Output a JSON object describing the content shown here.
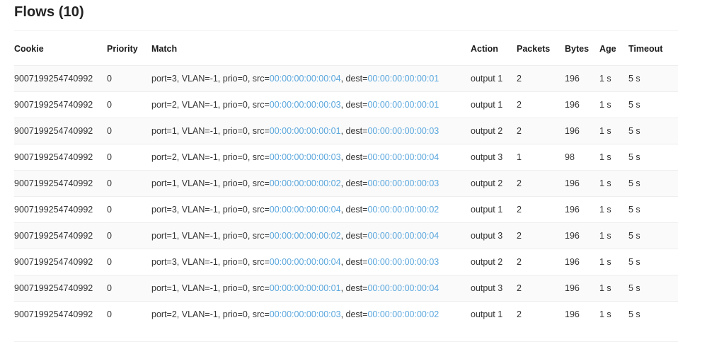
{
  "page": {
    "title": "Flows (10)"
  },
  "table": {
    "columns": [
      {
        "key": "cookie",
        "label": "Cookie"
      },
      {
        "key": "priority",
        "label": "Priority"
      },
      {
        "key": "match",
        "label": "Match"
      },
      {
        "key": "action",
        "label": "Action"
      },
      {
        "key": "packets",
        "label": "Packets"
      },
      {
        "key": "bytes",
        "label": "Bytes"
      },
      {
        "key": "age",
        "label": "Age"
      },
      {
        "key": "timeout",
        "label": "Timeout"
      }
    ],
    "mac_color": "#5ba7dd",
    "rows": [
      {
        "cookie": "9007199254740992",
        "priority": "0",
        "match_prefix": "port=3, VLAN=-1, prio=0, src=",
        "match_src": "00:00:00:00:00:04",
        "match_mid": ", dest=",
        "match_dest": "00:00:00:00:00:01",
        "action": "output 1",
        "packets": "2",
        "bytes": "196",
        "age": "1 s",
        "timeout": "5 s"
      },
      {
        "cookie": "9007199254740992",
        "priority": "0",
        "match_prefix": "port=2, VLAN=-1, prio=0, src=",
        "match_src": "00:00:00:00:00:03",
        "match_mid": ", dest=",
        "match_dest": "00:00:00:00:00:01",
        "action": "output 1",
        "packets": "2",
        "bytes": "196",
        "age": "1 s",
        "timeout": "5 s"
      },
      {
        "cookie": "9007199254740992",
        "priority": "0",
        "match_prefix": "port=1, VLAN=-1, prio=0, src=",
        "match_src": "00:00:00:00:00:01",
        "match_mid": ", dest=",
        "match_dest": "00:00:00:00:00:03",
        "action": "output 2",
        "packets": "2",
        "bytes": "196",
        "age": "1 s",
        "timeout": "5 s"
      },
      {
        "cookie": "9007199254740992",
        "priority": "0",
        "match_prefix": "port=2, VLAN=-1, prio=0, src=",
        "match_src": "00:00:00:00:00:03",
        "match_mid": ", dest=",
        "match_dest": "00:00:00:00:00:04",
        "action": "output 3",
        "packets": "1",
        "bytes": "98",
        "age": "1 s",
        "timeout": "5 s"
      },
      {
        "cookie": "9007199254740992",
        "priority": "0",
        "match_prefix": "port=1, VLAN=-1, prio=0, src=",
        "match_src": "00:00:00:00:00:02",
        "match_mid": ", dest=",
        "match_dest": "00:00:00:00:00:03",
        "action": "output 2",
        "packets": "2",
        "bytes": "196",
        "age": "1 s",
        "timeout": "5 s"
      },
      {
        "cookie": "9007199254740992",
        "priority": "0",
        "match_prefix": "port=3, VLAN=-1, prio=0, src=",
        "match_src": "00:00:00:00:00:04",
        "match_mid": ", dest=",
        "match_dest": "00:00:00:00:00:02",
        "action": "output 1",
        "packets": "2",
        "bytes": "196",
        "age": "1 s",
        "timeout": "5 s"
      },
      {
        "cookie": "9007199254740992",
        "priority": "0",
        "match_prefix": "port=1, VLAN=-1, prio=0, src=",
        "match_src": "00:00:00:00:00:02",
        "match_mid": ", dest=",
        "match_dest": "00:00:00:00:00:04",
        "action": "output 3",
        "packets": "2",
        "bytes": "196",
        "age": "1 s",
        "timeout": "5 s"
      },
      {
        "cookie": "9007199254740992",
        "priority": "0",
        "match_prefix": "port=3, VLAN=-1, prio=0, src=",
        "match_src": "00:00:00:00:00:04",
        "match_mid": ", dest=",
        "match_dest": "00:00:00:00:00:03",
        "action": "output 2",
        "packets": "2",
        "bytes": "196",
        "age": "1 s",
        "timeout": "5 s"
      },
      {
        "cookie": "9007199254740992",
        "priority": "0",
        "match_prefix": "port=1, VLAN=-1, prio=0, src=",
        "match_src": "00:00:00:00:00:01",
        "match_mid": ", dest=",
        "match_dest": "00:00:00:00:00:04",
        "action": "output 3",
        "packets": "2",
        "bytes": "196",
        "age": "1 s",
        "timeout": "5 s"
      },
      {
        "cookie": "9007199254740992",
        "priority": "0",
        "match_prefix": "port=2, VLAN=-1, prio=0, src=",
        "match_src": "00:00:00:00:00:03",
        "match_mid": ", dest=",
        "match_dest": "00:00:00:00:00:02",
        "action": "output 1",
        "packets": "2",
        "bytes": "196",
        "age": "1 s",
        "timeout": "5 s"
      }
    ]
  }
}
